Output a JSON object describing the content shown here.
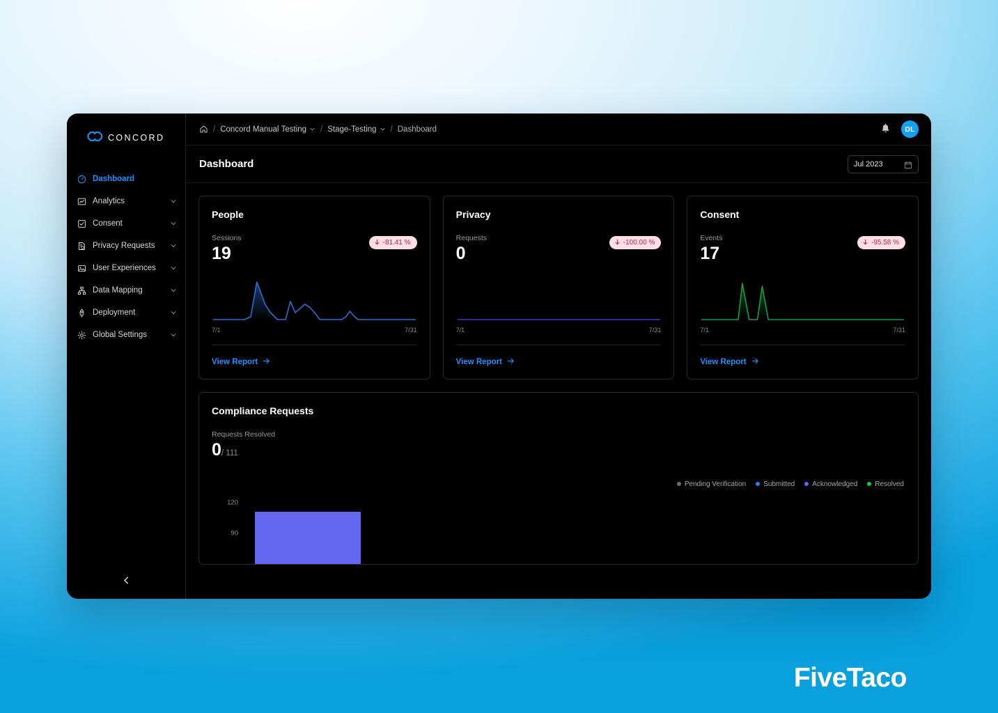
{
  "brand": {
    "name": "CONCORD",
    "logo_icon": "concord-cloud-logo",
    "accent": "#1e90ff"
  },
  "sidebar": {
    "items": [
      {
        "label": "Dashboard",
        "icon": "gauge-icon",
        "active": true,
        "expandable": false
      },
      {
        "label": "Analytics",
        "icon": "chart-box-icon",
        "active": false,
        "expandable": true
      },
      {
        "label": "Consent",
        "icon": "checkbox-icon",
        "active": false,
        "expandable": true
      },
      {
        "label": "Privacy Requests",
        "icon": "document-shield-icon",
        "active": false,
        "expandable": true
      },
      {
        "label": "User Experiences",
        "icon": "image-icon",
        "active": false,
        "expandable": true
      },
      {
        "label": "Data Mapping",
        "icon": "sitemap-icon",
        "active": false,
        "expandable": true
      },
      {
        "label": "Deployment",
        "icon": "rocket-icon",
        "active": false,
        "expandable": true
      },
      {
        "label": "Global Settings",
        "icon": "gear-icon",
        "active": false,
        "expandable": true
      }
    ],
    "collapse_icon": "chevron-left-icon"
  },
  "topbar": {
    "home_icon": "home-icon",
    "breadcrumbs": [
      {
        "label": "Concord Manual Testing",
        "has_dropdown": true
      },
      {
        "label": "Stage-Testing",
        "has_dropdown": true
      },
      {
        "label": "Dashboard",
        "has_dropdown": false
      }
    ],
    "separator": "/",
    "bell_icon": "bell-icon",
    "avatar_initials": "DL",
    "avatar_color": "#13a0f5"
  },
  "page": {
    "title": "Dashboard",
    "date_picker": {
      "value": "Jul 2023",
      "icon": "calendar-icon"
    }
  },
  "cards": [
    {
      "title": "People",
      "metric_label": "Sessions",
      "metric_value": "19",
      "delta": "-81.41 %",
      "delta_direction": "down",
      "delta_color": "#c02545",
      "delta_bg": "#fbdfe5",
      "x_start": "7/1",
      "x_end": "7/31",
      "line_color": "#2f6fd0",
      "link_label": "View Report",
      "link_icon": "arrow-right-icon"
    },
    {
      "title": "Privacy",
      "metric_label": "Requests",
      "metric_value": "0",
      "delta": "-100.00 %",
      "delta_direction": "down",
      "delta_color": "#c02545",
      "delta_bg": "#fbdfe5",
      "x_start": "7/1",
      "x_end": "7/31",
      "line_color": "#3b3bc4",
      "link_label": "View Report",
      "link_icon": "arrow-right-icon"
    },
    {
      "title": "Consent",
      "metric_label": "Events",
      "metric_value": "17",
      "delta": "-95.58 %",
      "delta_direction": "down",
      "delta_color": "#c02545",
      "delta_bg": "#fbdfe5",
      "x_start": "7/1",
      "x_end": "7/31",
      "line_color": "#14a04a",
      "link_label": "View Report",
      "link_icon": "arrow-right-icon"
    }
  ],
  "compliance": {
    "title": "Compliance Requests",
    "metric_label": "Requests Resolved",
    "metric_value": "0",
    "metric_total": "/ 111"
  },
  "watermark": "FiveTaco",
  "chart_data": [
    {
      "type": "line",
      "title": "People — Sessions",
      "xlabel": "",
      "ylabel": "Sessions",
      "x": [
        "7/1",
        "7/2",
        "7/3",
        "7/4",
        "7/5",
        "7/6",
        "7/7",
        "7/8",
        "7/9",
        "7/10",
        "7/11",
        "7/12",
        "7/13",
        "7/14",
        "7/15",
        "7/16",
        "7/17",
        "7/18",
        "7/19",
        "7/20",
        "7/21",
        "7/22",
        "7/23",
        "7/24",
        "7/25",
        "7/26",
        "7/27",
        "7/28",
        "7/29",
        "7/30",
        "7/31"
      ],
      "values": [
        0,
        0,
        0,
        0,
        0,
        19,
        0,
        0,
        0,
        0,
        9,
        3,
        6,
        0,
        0,
        0,
        0,
        0,
        3,
        0,
        0,
        0,
        0,
        0,
        0,
        0,
        0,
        0,
        0,
        0,
        0
      ],
      "series": [
        {
          "name": "Sessions",
          "color": "#2f6fd0"
        }
      ],
      "ylim": [
        0,
        19
      ],
      "grid": false,
      "legend": "none"
    },
    {
      "type": "line",
      "title": "Privacy — Requests",
      "xlabel": "",
      "ylabel": "Requests",
      "x": [
        "7/1",
        "7/2",
        "7/3",
        "7/4",
        "7/5",
        "7/6",
        "7/7",
        "7/8",
        "7/9",
        "7/10",
        "7/11",
        "7/12",
        "7/13",
        "7/14",
        "7/15",
        "7/16",
        "7/17",
        "7/18",
        "7/19",
        "7/20",
        "7/21",
        "7/22",
        "7/23",
        "7/24",
        "7/25",
        "7/26",
        "7/27",
        "7/28",
        "7/29",
        "7/30",
        "7/31"
      ],
      "values": [
        0,
        0,
        0,
        0,
        0,
        0,
        0,
        0,
        0,
        0,
        0,
        0,
        0,
        0,
        0,
        0,
        0,
        0,
        0,
        0,
        0,
        0,
        0,
        0,
        0,
        0,
        0,
        0,
        0,
        0,
        0
      ],
      "series": [
        {
          "name": "Requests",
          "color": "#3b3bc4"
        }
      ],
      "ylim": [
        0,
        1
      ],
      "grid": false,
      "legend": "none"
    },
    {
      "type": "line",
      "title": "Consent — Events",
      "xlabel": "",
      "ylabel": "Events",
      "x": [
        "7/1",
        "7/2",
        "7/3",
        "7/4",
        "7/5",
        "7/6",
        "7/7",
        "7/8",
        "7/9",
        "7/10",
        "7/11",
        "7/12",
        "7/13",
        "7/14",
        "7/15",
        "7/16",
        "7/17",
        "7/18",
        "7/19",
        "7/20",
        "7/21",
        "7/22",
        "7/23",
        "7/24",
        "7/25",
        "7/26",
        "7/27",
        "7/28",
        "7/29",
        "7/30",
        "7/31"
      ],
      "values": [
        0,
        0,
        0,
        0,
        0,
        17,
        0,
        0,
        0,
        15,
        0,
        0,
        0,
        0,
        0,
        0,
        0,
        0,
        0,
        0,
        0,
        0,
        0,
        0,
        0,
        0,
        0,
        0,
        0,
        0,
        0
      ],
      "series": [
        {
          "name": "Events",
          "color": "#14a04a"
        }
      ],
      "ylim": [
        0,
        17
      ],
      "grid": false,
      "legend": "none"
    },
    {
      "type": "bar",
      "title": "Compliance Requests",
      "stacked": true,
      "categories": [
        "Jul 2023"
      ],
      "ylabel": "",
      "xlabel": "",
      "ylim": [
        0,
        120
      ],
      "yticks": [
        "120",
        "90"
      ],
      "grid": false,
      "legend_position": "top-right",
      "legend": [
        {
          "name": "Pending Verification",
          "color": "#6c6c76"
        },
        {
          "name": "Submitted",
          "color": "#2f7ef0"
        },
        {
          "name": "Acknowledged",
          "color": "#6366f1"
        },
        {
          "name": "Resolved",
          "color": "#16c456"
        }
      ],
      "series": [
        {
          "name": "Pending Verification",
          "color": "#6c6c76",
          "values": [
            0
          ]
        },
        {
          "name": "Submitted",
          "color": "#2f7ef0",
          "values": [
            8
          ]
        },
        {
          "name": "Acknowledged",
          "color": "#6366f1",
          "values": [
            103
          ]
        },
        {
          "name": "Resolved",
          "color": "#16c456",
          "values": [
            0
          ]
        }
      ]
    }
  ]
}
